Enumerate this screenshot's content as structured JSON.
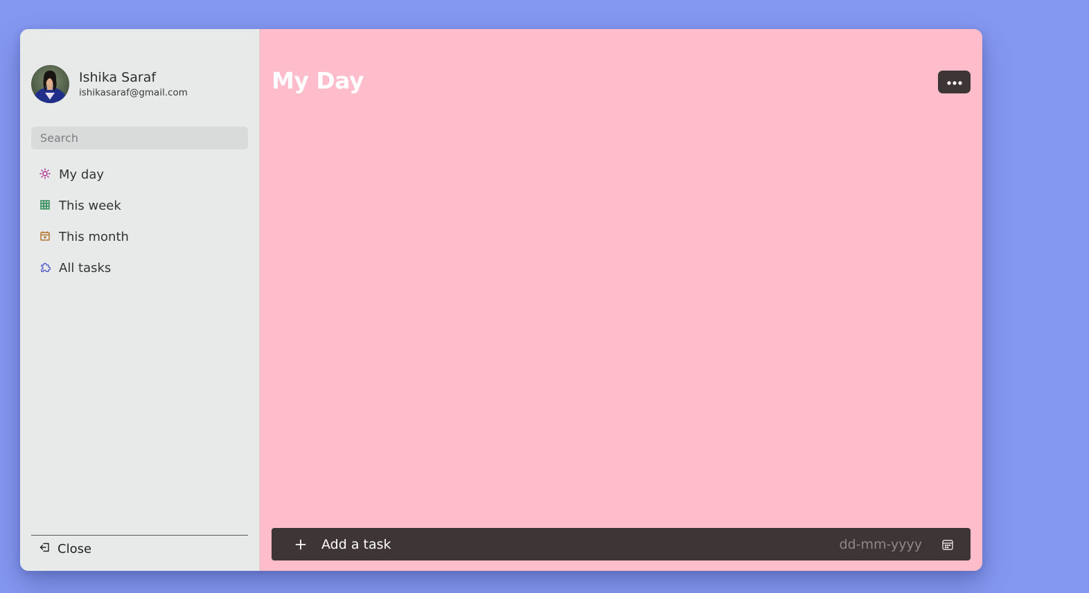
{
  "user": {
    "name": "Ishika Saraf",
    "email": "ishikasaraf@gmail.com"
  },
  "search": {
    "placeholder": "Search"
  },
  "sidebar": {
    "items": [
      {
        "label": "My day",
        "icon": "sun-icon",
        "color": "#b0288f"
      },
      {
        "label": "This week",
        "icon": "grid-icon",
        "color": "#2e8b57"
      },
      {
        "label": "This month",
        "icon": "calendar-icon",
        "color": "#b5742d"
      },
      {
        "label": "All tasks",
        "icon": "puzzle-icon",
        "color": "#4a55c8"
      }
    ],
    "close_label": "Close"
  },
  "main": {
    "title": "My Day",
    "more_icon": "ellipsis-icon"
  },
  "add_task": {
    "placeholder": "Add a task",
    "date_placeholder": "dd-mm-yyyy"
  },
  "colors": {
    "background": "#8498ef",
    "sidebar": "#e8e9e9",
    "main": "#ffbccb",
    "dark": "#3e3537"
  }
}
